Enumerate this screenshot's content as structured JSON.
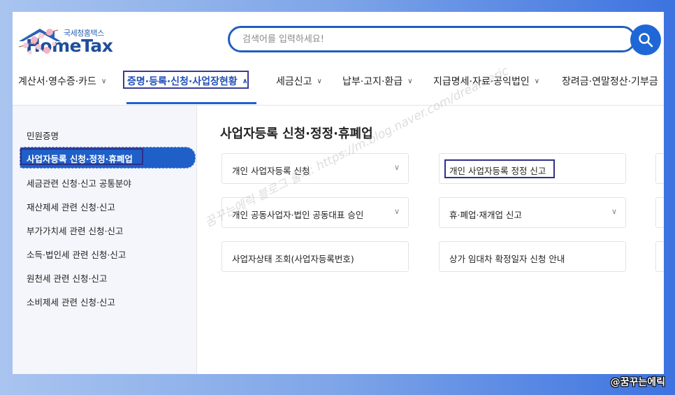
{
  "header": {
    "logo_sub": "국세청홈택스",
    "logo_main": "HomeTax",
    "search_placeholder": "검색어를 입력하세요!"
  },
  "gnb": {
    "items": [
      {
        "label": "계산서·영수증·카드",
        "active": false
      },
      {
        "label": "증명·등록·신청·사업장현황",
        "active": true
      },
      {
        "label": "세금신고",
        "active": false
      },
      {
        "label": "납부·고지·환급",
        "active": false
      },
      {
        "label": "지급명세·자료·공익법인",
        "active": false
      },
      {
        "label": "장려금·연말정산·기부금",
        "active": false
      }
    ]
  },
  "lnb": {
    "items": [
      {
        "label": "민원증명"
      },
      {
        "label": "사업자등록 신청·정정·휴폐업",
        "active": true
      },
      {
        "label": "세금관련 신청·신고 공통분야"
      },
      {
        "label": "재산제세 관련 신청·신고"
      },
      {
        "label": "부가가치세 관련 신청·신고"
      },
      {
        "label": "소득·법인세 관련 신청·신고"
      },
      {
        "label": "원천세 관련 신청·신고"
      },
      {
        "label": "소비제세 관련 신청·신고"
      }
    ]
  },
  "content": {
    "title": "사업자등록 신청·정정·휴폐업",
    "cards": [
      {
        "label": "개인 사업자등록 신청",
        "has_chevron": true
      },
      {
        "label": "개인 사업자등록 정정 신고",
        "has_chevron": false,
        "highlighted": true
      },
      {
        "label": "개인 공동사업자·법인 공동대표 승인",
        "has_chevron": true
      },
      {
        "label": "휴·폐업·재개업 신고",
        "has_chevron": true
      },
      {
        "label": "사업자상태 조회(사업자등록번호)",
        "has_chevron": false
      },
      {
        "label": "상가 임대차 확정일자 신청 안내",
        "has_chevron": false
      }
    ]
  },
  "overlay": {
    "watermark": "꿈꾸는에릭 블로그 출처: https://m.blog.naver.com/dreameric",
    "credit": "@꿈꾸는에릭"
  },
  "colors": {
    "brand": "#1f4e9c",
    "accent": "#1f62cf",
    "highlight_box": "#2f2f8a"
  }
}
